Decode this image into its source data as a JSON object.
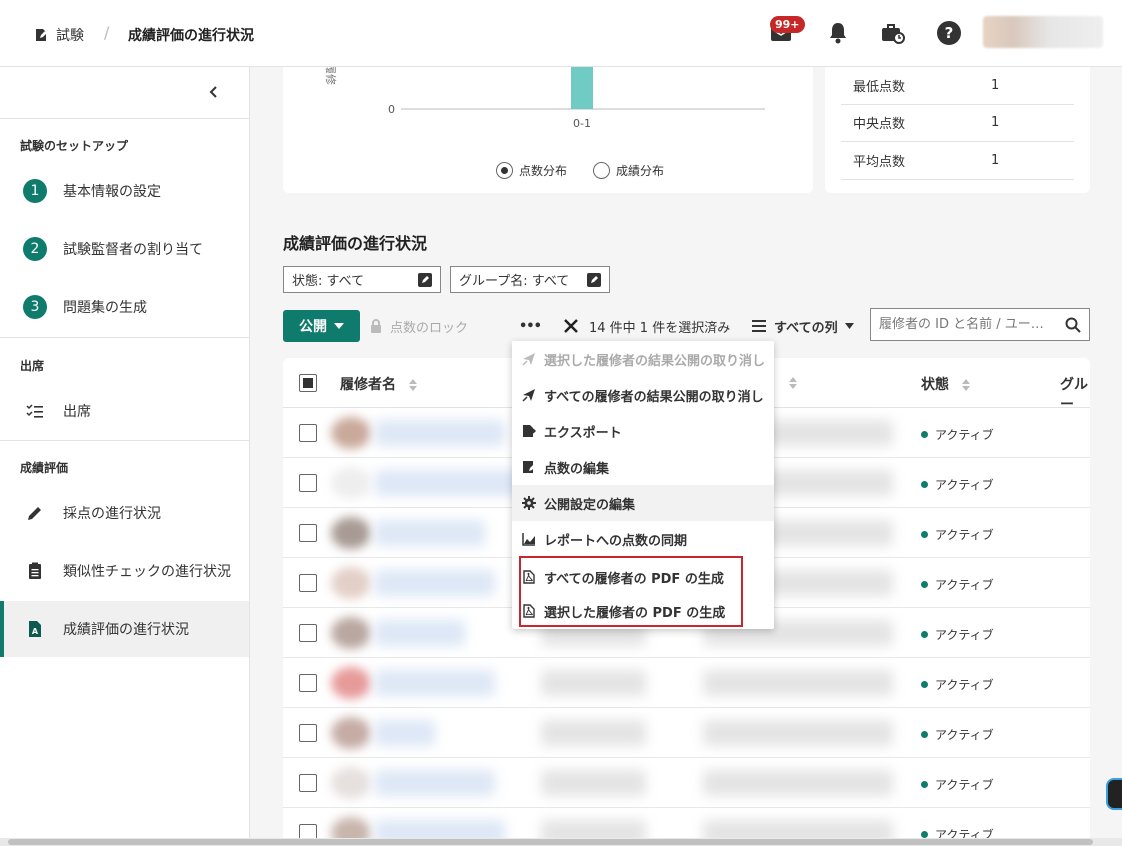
{
  "header": {
    "breadcrumb_root": "試験",
    "breadcrumb_sep": "/",
    "page_title": "成績評価の進行状況",
    "notification_badge": "99+"
  },
  "sidebar": {
    "sections": {
      "setup": "試験のセットアップ",
      "attendance": "出席",
      "grading": "成績評価"
    },
    "items": [
      {
        "num": "1",
        "label": "基本情報の設定"
      },
      {
        "num": "2",
        "label": "試験監督者の割り当て"
      },
      {
        "num": "3",
        "label": "問題集の生成"
      },
      {
        "label": "出席"
      },
      {
        "label": "採点の進行状況"
      },
      {
        "label": "類似性チェックの進行状況"
      },
      {
        "label": "成績評価の進行状況"
      }
    ]
  },
  "chart_card": {
    "y_tick": "0",
    "x_tick": "0-1",
    "ylabel_fragment": "履修",
    "radio_score": "点数分布",
    "radio_grade": "成績分布",
    "selected": "点数分布",
    "chart_data": {
      "type": "bar",
      "categories": [
        "0-1"
      ],
      "ylabel": "履修",
      "bar_color": "#6fcbc3"
    }
  },
  "stats": [
    {
      "label": "最低点数",
      "value": "1"
    },
    {
      "label": "中央点数",
      "value": "1"
    },
    {
      "label": "平均点数",
      "value": "1"
    }
  ],
  "section_title": "成績評価の進行状況",
  "filters": {
    "status": "状態: すべて",
    "group": "グループ名: すべて"
  },
  "toolbar": {
    "publish": "公開",
    "lock": "点数のロック",
    "more": "•••",
    "selection": "14 件中 1 件を選択済み",
    "columns": "すべての列",
    "search_placeholder": "履修者の ID と名前 / ユー…"
  },
  "table": {
    "columns": {
      "name": "履修者名",
      "status": "状態",
      "group": "グルー"
    },
    "status_value": "アクティブ",
    "rows": 9
  },
  "menu": {
    "items": [
      {
        "label": "選択した履修者の結果公開の取り消し",
        "disabled": true
      },
      {
        "label": "すべての履修者の結果公開の取り消し",
        "disabled": false
      },
      {
        "label": "エクスポート",
        "disabled": false
      },
      {
        "label": "点数の編集",
        "disabled": false
      },
      {
        "label": "公開設定の編集",
        "disabled": false
      },
      {
        "label": "レポートへの点数の同期",
        "disabled": false
      },
      {
        "label": "すべての履修者の PDF の生成",
        "disabled": false
      },
      {
        "label": "選択した履修者の PDF の生成",
        "disabled": false
      }
    ]
  },
  "colors": {
    "accent": "#0f7b6c",
    "badge": "#c62828",
    "highlight": "#c8272e"
  }
}
